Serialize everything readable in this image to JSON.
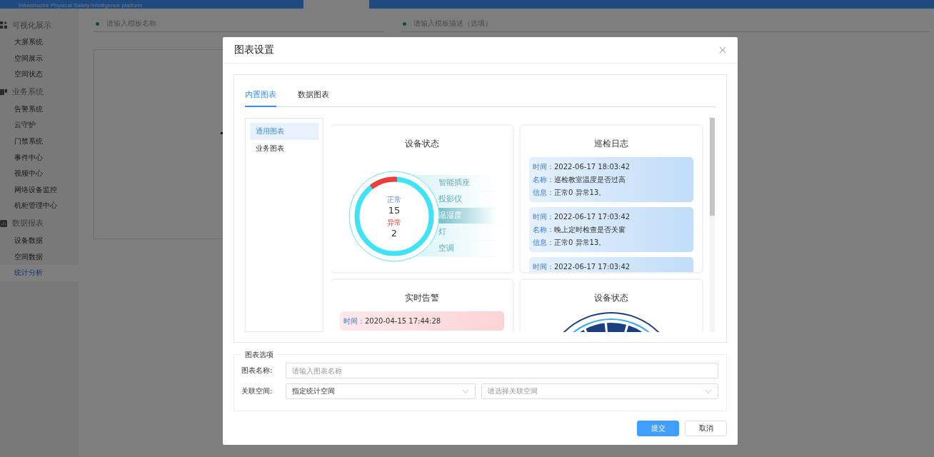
{
  "header": {
    "subtitle": "Infrastructre Physical Safety Intelligence platform"
  },
  "sidebar": {
    "groups": [
      {
        "label": "可视化展示",
        "items": [
          {
            "label": "大屏系统",
            "selected": false
          },
          {
            "label": "空间展示",
            "selected": false
          },
          {
            "label": "空间状态",
            "selected": false
          }
        ]
      },
      {
        "label": "业务系统",
        "items": [
          {
            "label": "告警系统",
            "selected": false
          },
          {
            "label": "云守护",
            "selected": false
          },
          {
            "label": "门禁系统",
            "selected": false
          },
          {
            "label": "事件中心",
            "selected": false
          },
          {
            "label": "视频中心",
            "selected": false
          },
          {
            "label": "网络设备监控",
            "selected": false
          },
          {
            "label": "机柜管理中心",
            "selected": false
          }
        ]
      },
      {
        "label": "数据报表",
        "items": [
          {
            "label": "设备数据",
            "selected": false
          },
          {
            "label": "空间数据",
            "selected": false
          },
          {
            "label": "统计分析",
            "selected": true
          }
        ]
      }
    ]
  },
  "form": {
    "name_placeholder": "请输入模板名称",
    "desc_placeholder": "请输入模板描述（选填）"
  },
  "dialog": {
    "title": "图表设置",
    "tabs": [
      {
        "label": "内置图表",
        "selected": true
      },
      {
        "label": "数据图表",
        "selected": false
      }
    ],
    "categories": [
      {
        "label": "通用图表",
        "selected": true
      },
      {
        "label": "业务图表",
        "selected": false
      }
    ],
    "charts": [
      {
        "kind": "ring",
        "title": "设备状态",
        "normal_label": "正常",
        "normal_value": "15",
        "abnormal_label": "异常",
        "abnormal_value": "2",
        "devices": [
          {
            "label": "智能插座",
            "selected": false
          },
          {
            "label": "投影仪",
            "selected": false
          },
          {
            "label": "温湿度",
            "selected": true
          },
          {
            "label": "灯",
            "selected": false
          },
          {
            "label": "空调",
            "selected": false
          }
        ]
      },
      {
        "kind": "log",
        "title": "巡检日志",
        "entries": [
          {
            "fields": [
              {
                "label": "时间：",
                "value": "2022-06-17 18:03:42"
              },
              {
                "label": "名称：",
                "value": "巡检教室温度是否过高"
              },
              {
                "label": "信息：",
                "value": "正常0 异常13。"
              }
            ]
          },
          {
            "fields": [
              {
                "label": "时间：",
                "value": "2022-06-17 17:03:42"
              },
              {
                "label": "名称：",
                "value": "晚上定时检查是否关窗"
              },
              {
                "label": "信息：",
                "value": "正常0 异常13。"
              }
            ]
          },
          {
            "fields": [
              {
                "label": "时间：",
                "value": "2022-06-17 17:03:42"
              }
            ]
          }
        ]
      },
      {
        "kind": "alarm",
        "title": "实时告警",
        "entries": [
          {
            "fields": [
              {
                "label": "时间：",
                "value": "2020-04-15 17:44:28"
              }
            ]
          }
        ]
      },
      {
        "kind": "gauge",
        "title": "设备状态"
      }
    ],
    "options": {
      "legend": "图表选项",
      "name_label": "图表名称:",
      "name_placeholder": "请输入图表名称",
      "space_label": "关联空间:",
      "space_value": "指定统计空间",
      "space_placeholder": "请选择关联空间"
    },
    "buttons": [
      {
        "label": "提交",
        "kind": "primary"
      },
      {
        "label": "取消",
        "kind": "default"
      }
    ]
  }
}
